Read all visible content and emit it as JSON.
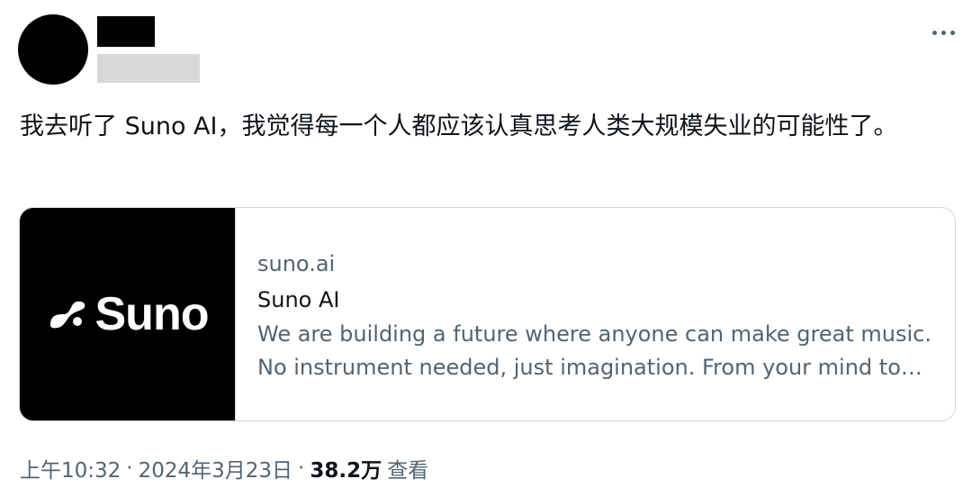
{
  "tweet": {
    "text": "我去听了 Suno AI，我觉得每一个人都应该认真思考人类大规模失业的可能性了。"
  },
  "header": {
    "more_icon": "more-horizontal-icon"
  },
  "card": {
    "domain": "suno.ai",
    "title": "Suno AI",
    "description": "We are building a future where anyone can make great music. No instrument needed, just imagination. From your mind to music.",
    "logo_text": "Suno",
    "logo_icon": "suno-wave-icon"
  },
  "meta": {
    "time": "上午10:32",
    "separator": "·",
    "date": "2024年3月23日",
    "views_count": "38.2万",
    "views_label": "查看"
  },
  "colors": {
    "text_primary": "#0f1419",
    "text_secondary": "#536471",
    "border": "#cfd9de",
    "thumb_background": "#000000"
  }
}
